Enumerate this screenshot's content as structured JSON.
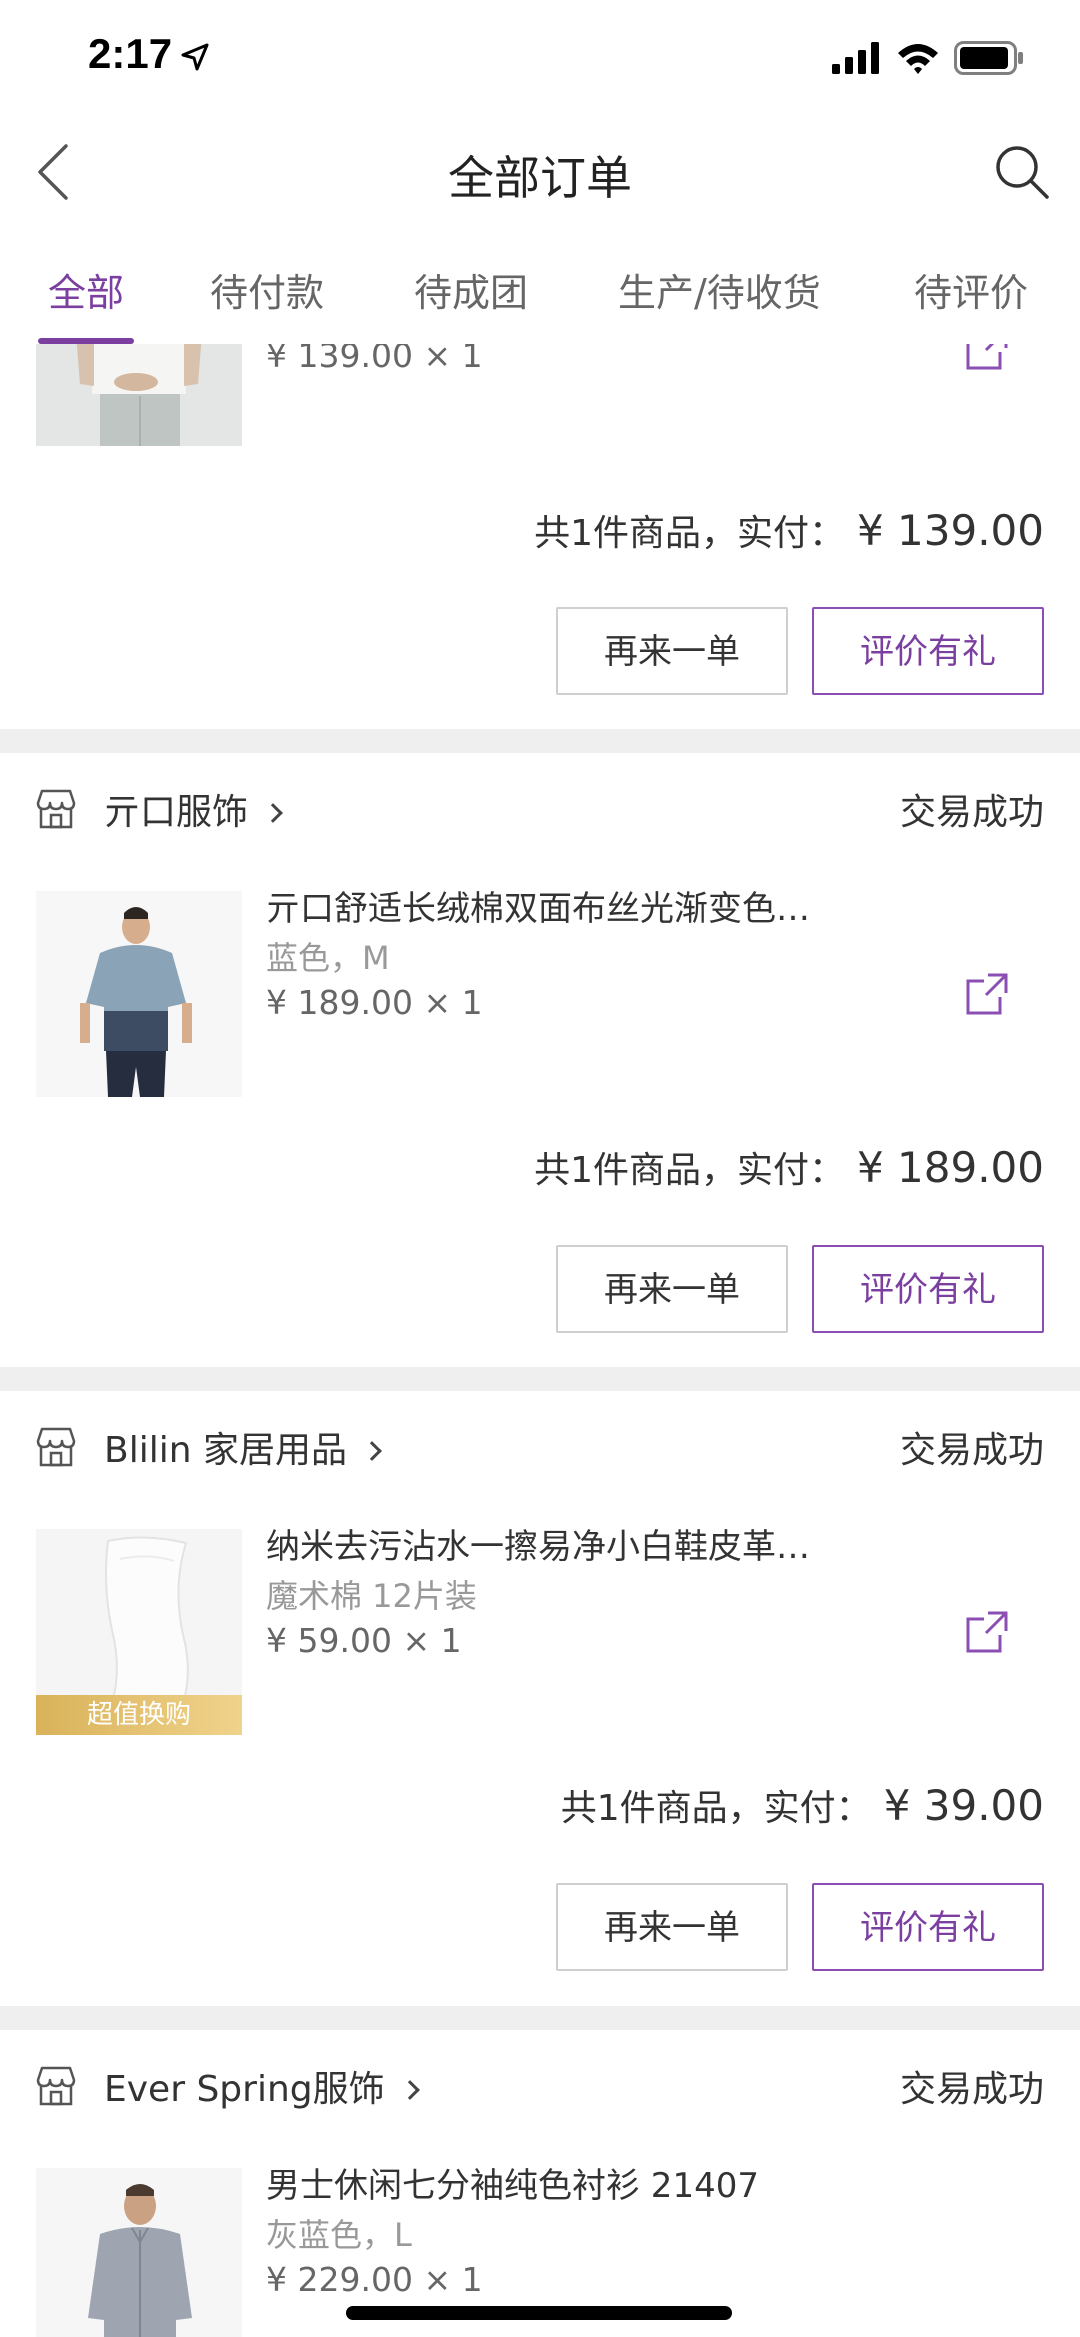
{
  "status_bar": {
    "time": "2:17"
  },
  "nav": {
    "title": "全部订单"
  },
  "tabs": [
    {
      "label": "全部",
      "active": true
    },
    {
      "label": "待付款",
      "active": false
    },
    {
      "label": "待成团",
      "active": false
    },
    {
      "label": "生产/待收货",
      "active": false
    },
    {
      "label": "待评价",
      "active": false
    }
  ],
  "orders": [
    {
      "shop": "",
      "status": "",
      "product": {
        "price_qty": "¥ 139.00 × 1"
      },
      "total_label": "共1件商品，实付：",
      "total_amount": "¥ 139.00",
      "reorder_label": "再来一单",
      "review_label": "评价有礼"
    },
    {
      "shop": "亓口服饰",
      "status": "交易成功",
      "product": {
        "title": "亓口舒适长绒棉双面布丝光渐变色…",
        "variant": "蓝色，M",
        "price_qty": "¥ 189.00 × 1"
      },
      "total_label": "共1件商品，实付：",
      "total_amount": "¥ 189.00",
      "reorder_label": "再来一单",
      "review_label": "评价有礼"
    },
    {
      "shop": "Blilin 家居用品",
      "status": "交易成功",
      "product": {
        "title": "纳米去污沾水一擦易净小白鞋皮革…",
        "variant": "魔术棉 12片装",
        "price_qty": "¥ 59.00 × 1",
        "badge": "超值换购"
      },
      "total_label": "共1件商品，实付：",
      "total_amount": "¥ 39.00",
      "reorder_label": "再来一单",
      "review_label": "评价有礼"
    },
    {
      "shop": "Ever Spring服饰",
      "status": "交易成功",
      "product": {
        "title": "男士休闲七分袖纯色衬衫 21407",
        "variant": "灰蓝色，L",
        "price_qty": "¥ 229.00 × 1"
      }
    }
  ],
  "colors": {
    "accent": "#7b3fa0",
    "separator": "#efefef",
    "badge": "#e3c170"
  },
  "icons": {
    "back": "chevron-left-icon",
    "search": "search-icon",
    "shop": "store-icon",
    "share": "share-icon",
    "location": "location-arrow-icon",
    "signal": "cellular-signal-icon",
    "wifi": "wifi-icon",
    "battery": "battery-icon"
  }
}
